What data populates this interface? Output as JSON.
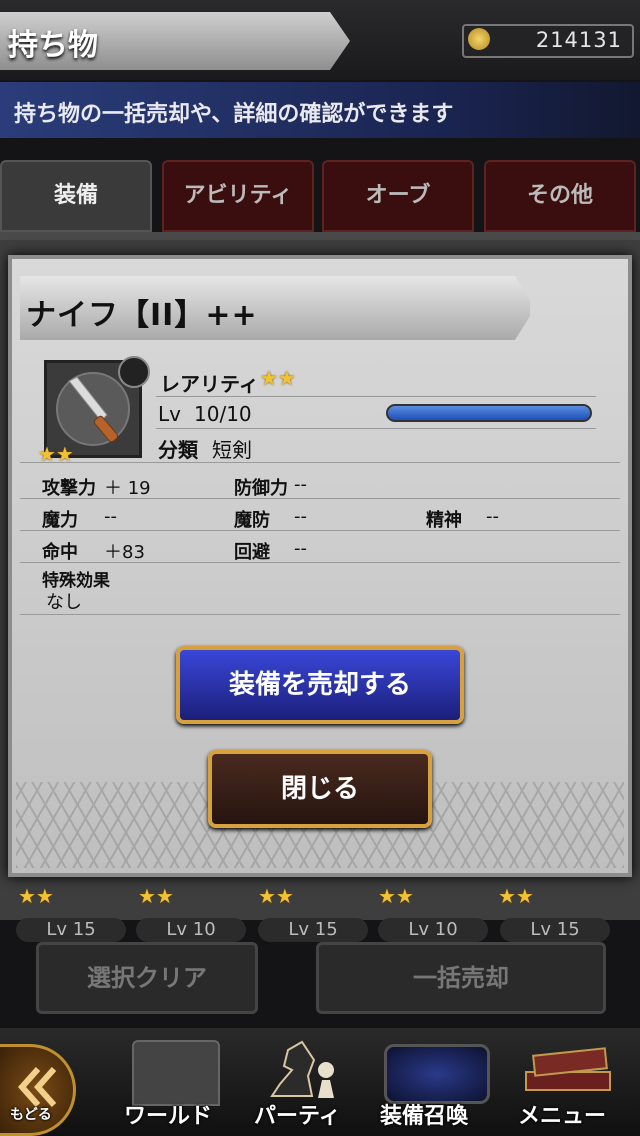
{
  "header": {
    "title": "持ち物",
    "gil": "214131",
    "subtitle": "持ち物の一括売却や、詳細の確認ができます"
  },
  "tabs": [
    {
      "label": "装備",
      "active": true
    },
    {
      "label": "アビリティ"
    },
    {
      "label": "オーブ"
    },
    {
      "label": "その他"
    }
  ],
  "item": {
    "name": "ナイフ【II】++",
    "rarity_label": "レアリティ",
    "rarity_stars": "★★",
    "level_prefix": "Lv",
    "level": "10/10",
    "level_progress": 1.0,
    "category_label": "分類",
    "category_value": "短剣",
    "stats": {
      "attack_label": "攻撃力",
      "attack_value": "＋ 19",
      "defense_label": "防御力",
      "defense_value": "--",
      "magic_label": "魔力",
      "magic_value": "--",
      "mdefense_label": "魔防",
      "mdefense_value": "--",
      "spirit_label": "精神",
      "spirit_value": "--",
      "accuracy_label": "命中",
      "accuracy_value": "＋83",
      "evasion_label": "回避",
      "evasion_value": "--"
    },
    "special_label": "特殊効果",
    "special_value": "なし"
  },
  "buttons": {
    "sell": "装備を売却する",
    "close": "閉じる"
  },
  "background": {
    "levels": [
      "Lv 15",
      "Lv 10",
      "Lv 15",
      "Lv 10",
      "Lv 15"
    ],
    "clear_button": "選択クリア",
    "bulk_sell_button": "一括売却"
  },
  "nav": {
    "back": "もどる",
    "world": "ワールド",
    "party": "パーティ",
    "summon": "装備召喚",
    "menu": "メニュー"
  },
  "colors": {
    "accent_blue": "#2a34c8",
    "gold_border": "#d7a13d"
  }
}
